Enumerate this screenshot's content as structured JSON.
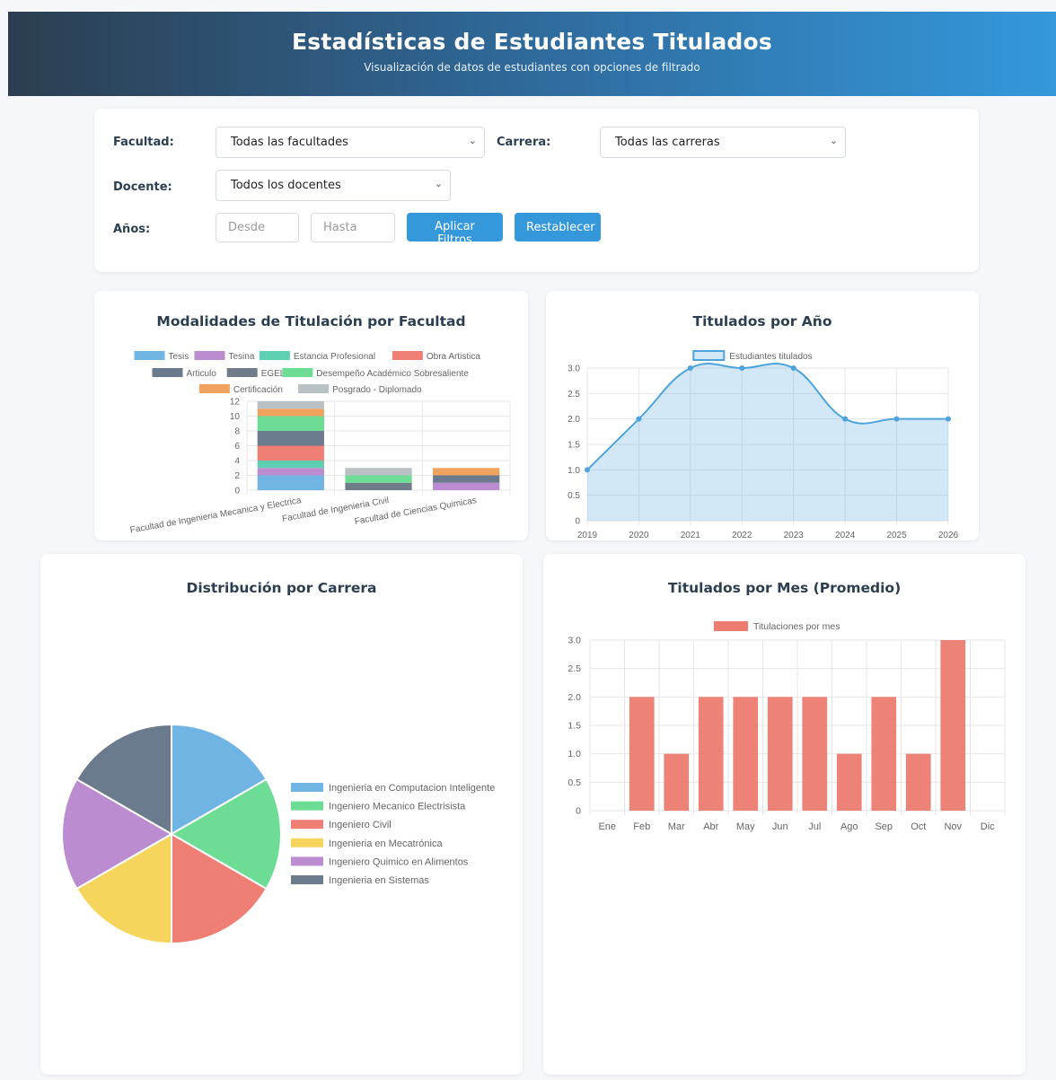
{
  "header": {
    "title": "Estadísticas de Estudiantes Titulados",
    "subtitle": "Visualización de datos de estudiantes con opciones de filtrado"
  },
  "filters": {
    "facultad_label": "Facultad:",
    "facultad_value": "Todas las facultades",
    "carrera_label": "Carrera:",
    "carrera_value": "Todas las carreras",
    "docente_label": "Docente:",
    "docente_value": "Todos los docentes",
    "anios_label": "Años:",
    "desde_placeholder": "Desde",
    "hasta_placeholder": "Hasta",
    "apply_label": "Aplicar Filtros",
    "reset_label": "Restablecer"
  },
  "icons": {
    "select_chevron": "chevron-down-icon"
  },
  "chart_data": [
    {
      "id": "modalidades",
      "type": "bar",
      "stacked": true,
      "title": "Modalidades de Titulación por Facultad",
      "categories": [
        "Facultad de Ingenieria Mecanica y Electrica",
        "Facultad de Ingenieria Civil",
        "Facultad de Ciencias Quimicas"
      ],
      "ylim": [
        0,
        12
      ],
      "yticks": [
        0,
        2,
        4,
        6,
        8,
        10,
        12
      ],
      "legend_position": "top",
      "series": [
        {
          "name": "Tesis",
          "color": "#6fb4e3",
          "values": [
            2,
            0,
            0
          ]
        },
        {
          "name": "Tesina",
          "color": "#bb8ccf",
          "values": [
            1,
            0,
            1
          ]
        },
        {
          "name": "Estancia Profesional",
          "color": "#5ecfb1",
          "values": [
            1,
            0,
            0
          ]
        },
        {
          "name": "Obra Artistica",
          "color": "#ef7f74",
          "values": [
            2,
            0,
            0
          ]
        },
        {
          "name": "Articulo",
          "color": "#6b7a8c",
          "values": [
            2,
            0,
            1
          ]
        },
        {
          "name": "EGEL",
          "color": "#707c8a",
          "values": [
            0,
            1,
            0
          ]
        },
        {
          "name": "Desempeño Académico Sobresaliente",
          "color": "#6ddc94",
          "values": [
            2,
            1,
            0
          ]
        },
        {
          "name": "Certificación",
          "color": "#f0a35e",
          "values": [
            1,
            0,
            1
          ]
        },
        {
          "name": "Posgrado - Diplomado",
          "color": "#b9c1c4",
          "values": [
            1,
            1,
            0
          ]
        }
      ]
    },
    {
      "id": "por_anio",
      "type": "area",
      "title": "Titulados por Año",
      "legend_position": "top",
      "x": [
        "2019",
        "2020",
        "2021",
        "2022",
        "2023",
        "2024",
        "2025",
        "2026"
      ],
      "series": [
        {
          "name": "Estudiantes titulados",
          "color": "#4fa3dc",
          "values": [
            1,
            2,
            3,
            3,
            3,
            2,
            2,
            2
          ]
        }
      ],
      "ylim": [
        0,
        3
      ],
      "yticks": [
        "0",
        "0.5",
        "1.0",
        "1.5",
        "2.0",
        "2.5",
        "3.0"
      ]
    },
    {
      "id": "por_carrera",
      "type": "pie",
      "title": "Distribución por Carrera",
      "legend_position": "right",
      "labels": [
        "Ingenieria en Computacion Inteligente",
        "Ingeniero Mecanico Electrisista",
        "Ingeniero Civil",
        "Ingenieria en Mecatrónica",
        "Ingeniero Quimico en Alimentos",
        "Ingenieria en Sistemas"
      ],
      "values": [
        1,
        1,
        1,
        1,
        1,
        1
      ],
      "colors": [
        "#6fb4e3",
        "#6ddc94",
        "#ef7f74",
        "#f6d55c",
        "#bb8ccf",
        "#6b7a8c"
      ]
    },
    {
      "id": "por_mes",
      "type": "bar",
      "title": "Titulados por Mes (Promedio)",
      "legend_position": "top",
      "categories": [
        "Ene",
        "Feb",
        "Mar",
        "Abr",
        "May",
        "Jun",
        "Jul",
        "Ago",
        "Sep",
        "Oct",
        "Nov",
        "Dic"
      ],
      "series": [
        {
          "name": "Titulaciones por mes",
          "color": "#ec7b70",
          "values": [
            0,
            2,
            1,
            2,
            2,
            2,
            2,
            1,
            2,
            1,
            3,
            0
          ]
        }
      ],
      "ylim": [
        0,
        3
      ],
      "yticks": [
        "0",
        "0.5",
        "1.0",
        "1.5",
        "2.0",
        "2.5",
        "3.0"
      ]
    }
  ]
}
